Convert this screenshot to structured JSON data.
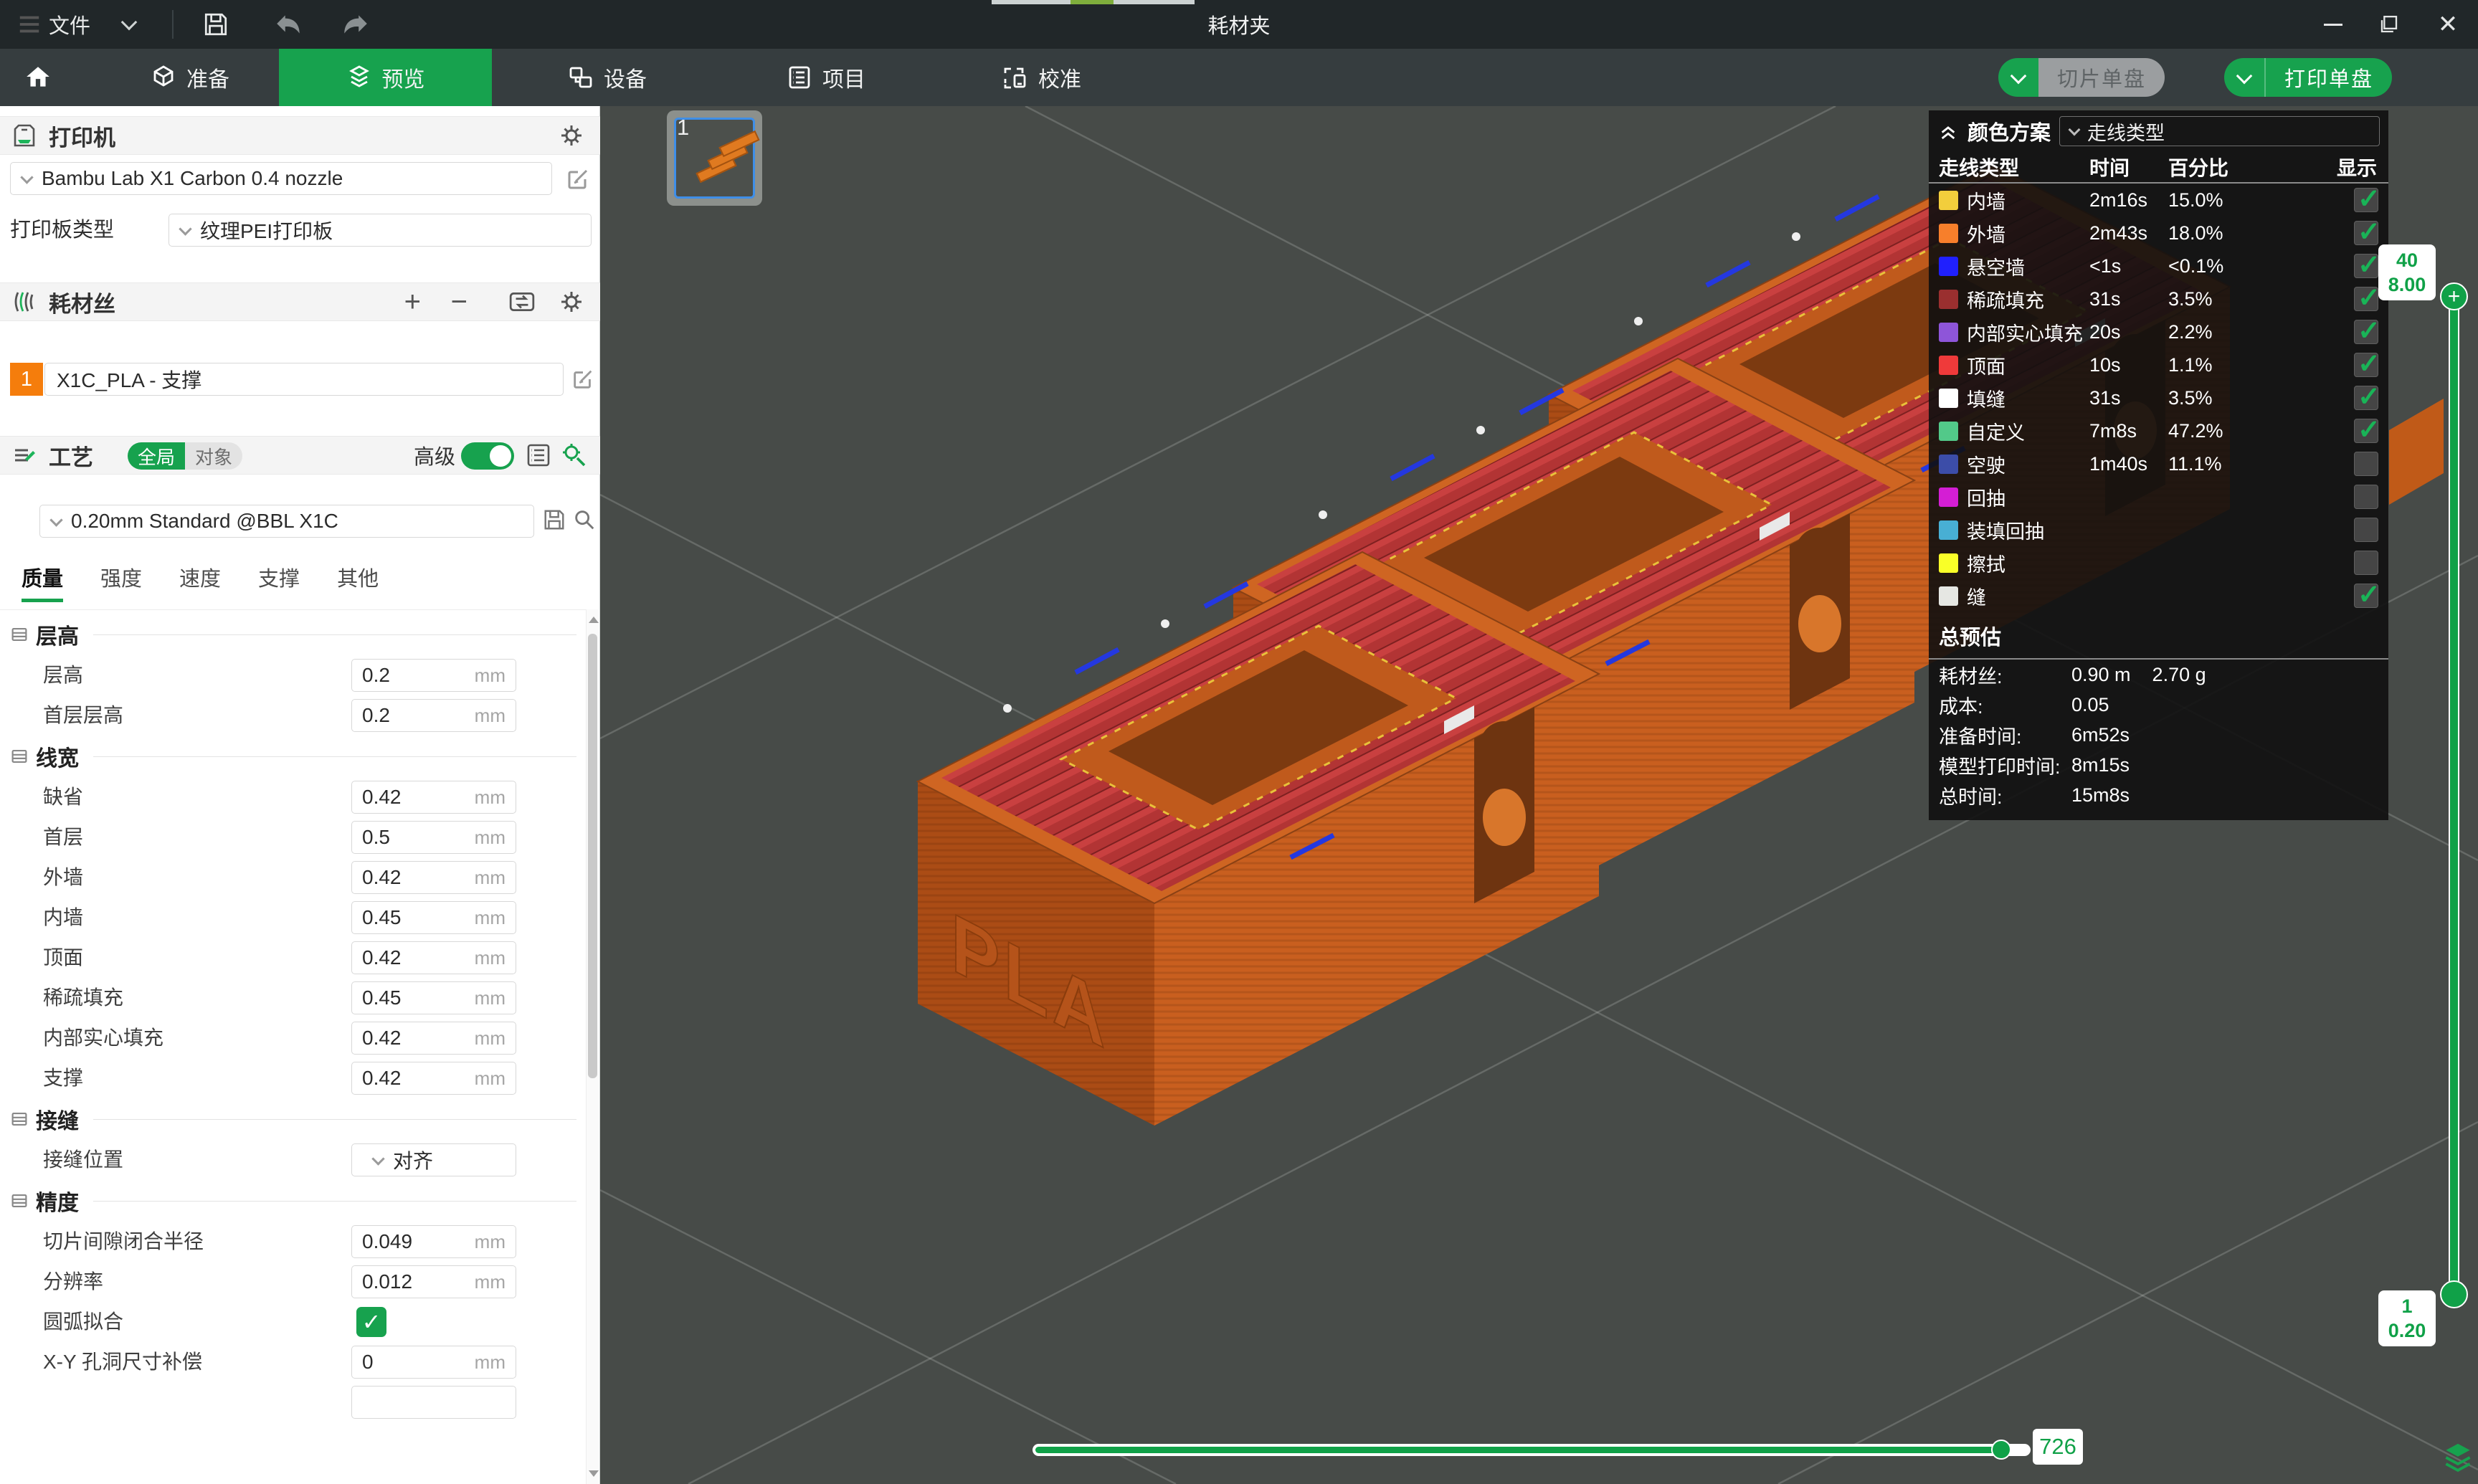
{
  "window": {
    "menu": "文件",
    "title": "耗材夹"
  },
  "nav": {
    "tabs": [
      {
        "label": "准备"
      },
      {
        "label": "预览"
      },
      {
        "label": "设备"
      },
      {
        "label": "项目"
      },
      {
        "label": "校准"
      }
    ],
    "active": "预览"
  },
  "actions": {
    "slice": "切片单盘",
    "print": "打印单盘"
  },
  "plate": {
    "number": "1"
  },
  "printer": {
    "title": "打印机",
    "name": "Bambu Lab X1 Carbon 0.4 nozzle",
    "plate_type_label": "打印板类型",
    "plate_type": "纹理PEI打印板"
  },
  "filament": {
    "title": "耗材丝",
    "slot": "1",
    "name": "X1C_PLA - 支撑"
  },
  "process": {
    "title": "工艺",
    "scope": [
      {
        "label": "全局"
      },
      {
        "label": "对象"
      }
    ],
    "advanced_label": "高级",
    "advanced_on": true,
    "preset": "0.20mm Standard @BBL X1C",
    "tabs": [
      "质量",
      "强度",
      "速度",
      "支撑",
      "其他"
    ],
    "active_tab": "质量"
  },
  "params": {
    "sections": [
      {
        "title": "层高",
        "rows": [
          {
            "label": "层高",
            "type": "input",
            "value": "0.2",
            "unit": "mm"
          },
          {
            "label": "首层层高",
            "type": "input",
            "value": "0.2",
            "unit": "mm"
          }
        ]
      },
      {
        "title": "线宽",
        "rows": [
          {
            "label": "缺省",
            "type": "input",
            "value": "0.42",
            "unit": "mm"
          },
          {
            "label": "首层",
            "type": "input",
            "value": "0.5",
            "unit": "mm"
          },
          {
            "label": "外墙",
            "type": "input",
            "value": "0.42",
            "unit": "mm"
          },
          {
            "label": "内墙",
            "type": "input",
            "value": "0.45",
            "unit": "mm"
          },
          {
            "label": "顶面",
            "type": "input",
            "value": "0.42",
            "unit": "mm"
          },
          {
            "label": "稀疏填充",
            "type": "input",
            "value": "0.45",
            "unit": "mm"
          },
          {
            "label": "内部实心填充",
            "type": "input",
            "value": "0.42",
            "unit": "mm"
          },
          {
            "label": "支撑",
            "type": "input",
            "value": "0.42",
            "unit": "mm"
          }
        ]
      },
      {
        "title": "接缝",
        "rows": [
          {
            "label": "接缝位置",
            "type": "select",
            "value": "对齐"
          }
        ]
      },
      {
        "title": "精度",
        "rows": [
          {
            "label": "切片间隙闭合半径",
            "type": "input",
            "value": "0.049",
            "unit": "mm"
          },
          {
            "label": "分辨率",
            "type": "input",
            "value": "0.012",
            "unit": "mm"
          },
          {
            "label": "圆弧拟合",
            "type": "checkbox",
            "checked": true
          },
          {
            "label": "X-Y 孔洞尺寸补偿",
            "type": "input",
            "value": "0",
            "unit": "mm"
          }
        ]
      }
    ]
  },
  "legend": {
    "title": "颜色方案",
    "scheme": "走线类型",
    "columns": [
      "走线类型",
      "时间",
      "百分比",
      "显示"
    ],
    "rows": [
      {
        "name": "内墙",
        "color": "#F2CE3C",
        "time": "2m16s",
        "percent": "15.0%",
        "checked": true
      },
      {
        "name": "外墙",
        "color": "#F77F2B",
        "time": "2m43s",
        "percent": "18.0%",
        "checked": true
      },
      {
        "name": "悬空墙",
        "color": "#2020FE",
        "time": "<1s",
        "percent": "<0.1%",
        "checked": true
      },
      {
        "name": "稀疏填充",
        "color": "#9A2F2F",
        "time": "31s",
        "percent": "3.5%",
        "checked": true
      },
      {
        "name": "内部实心填充",
        "color": "#8E55D9",
        "time": "20s",
        "percent": "2.2%",
        "checked": true
      },
      {
        "name": "顶面",
        "color": "#EF3A3A",
        "time": "10s",
        "percent": "1.1%",
        "checked": true
      },
      {
        "name": "填缝",
        "color": "#FFFFFF",
        "time": "31s",
        "percent": "3.5%",
        "checked": true
      },
      {
        "name": "自定义",
        "color": "#52C989",
        "time": "7m8s",
        "percent": "47.2%",
        "checked": true
      },
      {
        "name": "空驶",
        "color": "#3C4DA8",
        "time": "1m40s",
        "percent": "11.1%",
        "checked": false
      },
      {
        "name": "回抽",
        "color": "#D41ED4",
        "time": "",
        "percent": "",
        "checked": false
      },
      {
        "name": "装填回抽",
        "color": "#48AFD4",
        "time": "",
        "percent": "",
        "checked": false
      },
      {
        "name": "擦拭",
        "color": "#F9FF28",
        "time": "",
        "percent": "",
        "checked": false
      },
      {
        "name": "缝",
        "color": "#E6E7E3",
        "time": "",
        "percent": "",
        "checked": true
      }
    ],
    "estimate": {
      "title": "总预估",
      "rows": [
        {
          "label": "耗材丝:",
          "value": "0.90 m",
          "value2": "2.70 g"
        },
        {
          "label": "成本:",
          "value": "0.05",
          "value2": ""
        },
        {
          "label": "准备时间:",
          "value": "6m52s",
          "value2": ""
        },
        {
          "label": "模型打印时间:",
          "value": "8m15s",
          "value2": ""
        },
        {
          "label": "总时间:",
          "value": "15m8s",
          "value2": ""
        }
      ]
    }
  },
  "sliders": {
    "layer_slider": {
      "top_layer": "40",
      "top_height": "8.00",
      "bottom_layer": "1",
      "bottom_height": "0.20"
    },
    "progress_slider": {
      "value": "726"
    }
  },
  "model": {
    "label": "PLA"
  },
  "colors": {
    "accent_green": "#17a24e",
    "filament_orange": "#f57d0c",
    "viewport_bg": "#474b48",
    "model_orange": "#cd6321",
    "top_infill_red": "#b23434"
  }
}
